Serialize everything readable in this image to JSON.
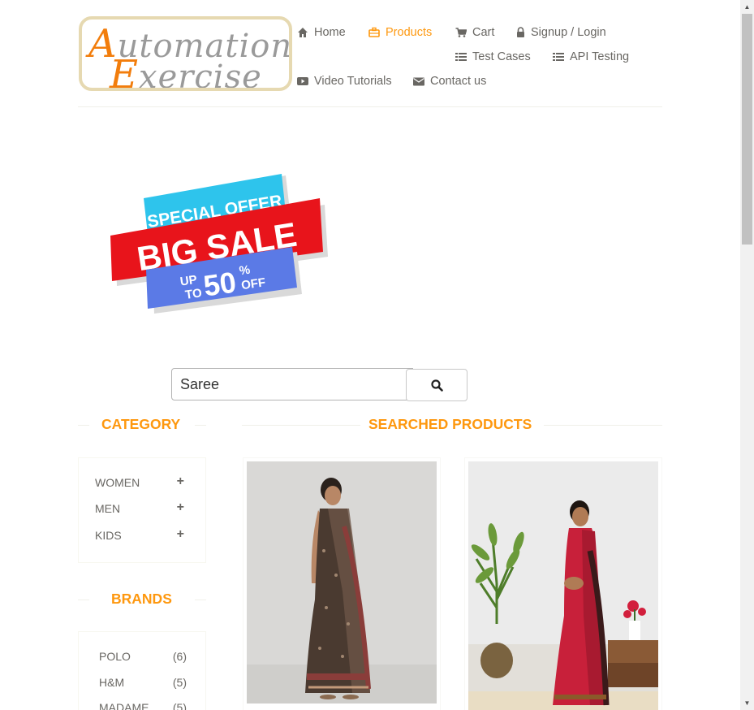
{
  "logo": {
    "line1_cap": "A",
    "line1_rest": "utomation",
    "line2_cap": "E",
    "line2_rest": "xercise"
  },
  "nav": {
    "home": "Home",
    "products": "Products",
    "cart": "Cart",
    "signup_login": "Signup / Login",
    "test_cases": "Test Cases",
    "api_testing": "API Testing",
    "video_tutorials": "Video Tutorials",
    "contact_us": "Contact us"
  },
  "banner": {
    "line1": "SPECIAL OFFER",
    "line2": "BIG SALE",
    "up": "UP",
    "to": "TO",
    "percent_value": "50",
    "percent_sign": "%",
    "off": "OFF"
  },
  "search": {
    "value": "Saree"
  },
  "sidebar": {
    "category_title": "CATEGORY",
    "categories": [
      {
        "label": "WOMEN"
      },
      {
        "label": "MEN"
      },
      {
        "label": "KIDS"
      }
    ],
    "brands_title": "BRANDS",
    "brands": [
      {
        "label": "POLO",
        "count": "(6)"
      },
      {
        "label": "H&M",
        "count": "(5)"
      },
      {
        "label": "MADAME",
        "count": "(5)"
      }
    ]
  },
  "products_title": "SEARCHED PRODUCTS",
  "colors": {
    "accent": "#fe980f",
    "text": "#696763",
    "logo_orange": "#f27d0c",
    "sale_red": "#e8141b",
    "sale_blue": "#5b7ae6",
    "sale_cyan": "#2ec4ec"
  }
}
